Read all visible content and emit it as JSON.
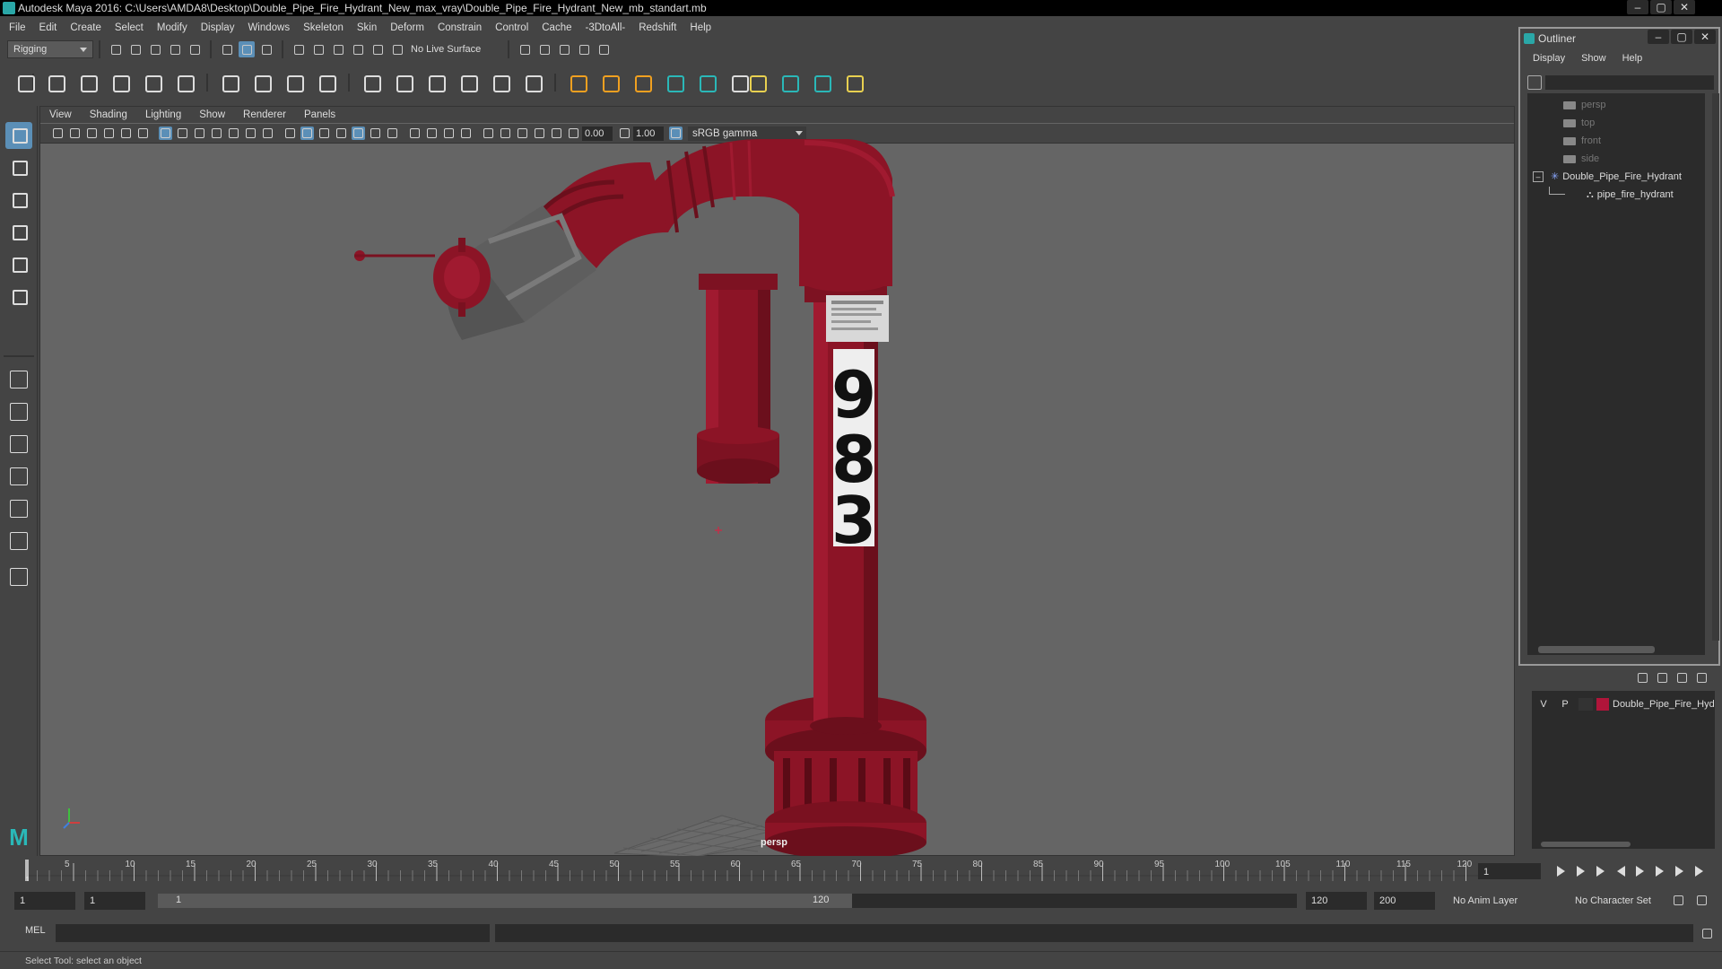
{
  "window": {
    "title": "Autodesk Maya 2016: C:\\Users\\AMDA8\\Desktop\\Double_Pipe_Fire_Hydrant_New_max_vray\\Double_Pipe_Fire_Hydrant_New_mb_standart.mb"
  },
  "menubar": {
    "items": [
      "File",
      "Edit",
      "Create",
      "Select",
      "Modify",
      "Display",
      "Windows",
      "Skeleton",
      "Skin",
      "Deform",
      "Constrain",
      "Control",
      "Cache",
      "-3DtoAll-",
      "Redshift",
      "Help"
    ]
  },
  "statusline": {
    "menuset": "Rigging",
    "live_surface": "No Live Surface"
  },
  "viewport": {
    "menu": [
      "View",
      "Shading",
      "Lighting",
      "Show",
      "Renderer",
      "Panels"
    ],
    "exposure": "0.00",
    "gamma": "1.00",
    "color_space": "sRGB gamma",
    "camera_label": "persp",
    "model_number": [
      "9",
      "8",
      "3"
    ],
    "colors": {
      "hydrant_red": "#8c1426",
      "fitting_gray": "#5e5e5e",
      "background": "#656565"
    }
  },
  "outliner": {
    "title": "Outliner",
    "menu": [
      "Display",
      "Show",
      "Help"
    ],
    "cameras": [
      "persp",
      "top",
      "front",
      "side"
    ],
    "group": "Double_Pipe_Fire_Hydrant",
    "child": "pipe_fire_hydrant"
  },
  "layers": {
    "v": "V",
    "p": "P",
    "layer_name": "Double_Pipe_Fire_Hyd",
    "layer_color": "#b0153a"
  },
  "timeslider": {
    "ticks": [
      "5",
      "10",
      "15",
      "20",
      "25",
      "30",
      "35",
      "40",
      "45",
      "50",
      "55",
      "60",
      "65",
      "70",
      "75",
      "80",
      "85",
      "90",
      "95",
      "100",
      "105",
      "110",
      "115",
      "120"
    ],
    "first_tick": "1",
    "current_frame": "1"
  },
  "range": {
    "start": "1",
    "playback_start": "1",
    "slider_start": "1",
    "slider_end": "120",
    "playback_end": "120",
    "end": "200",
    "anim_layer": "No Anim Layer",
    "character_set": "No Character Set"
  },
  "command": {
    "label": "MEL"
  },
  "help_line": "Select Tool: select an object"
}
